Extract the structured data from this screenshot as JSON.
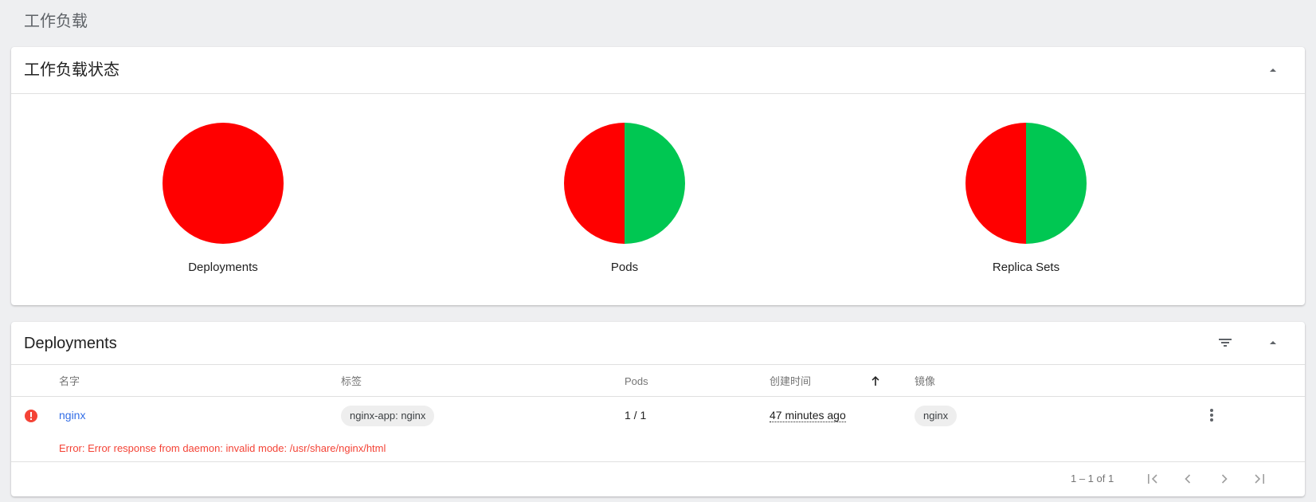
{
  "page": {
    "title": "工作负载"
  },
  "status_card": {
    "title": "工作负载状态",
    "charts": [
      {
        "label": "Deployments",
        "failed": 1,
        "running": 0
      },
      {
        "label": "Pods",
        "failed": 1,
        "running": 1
      },
      {
        "label": "Replica Sets",
        "failed": 1,
        "running": 1
      }
    ],
    "colors": {
      "failed": "#ff0000",
      "running": "#00c752"
    }
  },
  "deployments_card": {
    "title": "Deployments",
    "columns": {
      "name": "名字",
      "labels": "标签",
      "pods": "Pods",
      "created": "创建时间",
      "images": "镜像"
    },
    "rows": [
      {
        "status": "error",
        "name": "nginx",
        "label": "nginx-app: nginx",
        "pods": "1 / 1",
        "created": "47 minutes ago",
        "image": "nginx",
        "error": "Error: Error response from daemon: invalid mode: /usr/share/nginx/html"
      }
    ],
    "pagination": {
      "range": "1 – 1 of 1"
    }
  },
  "icons": {
    "collapse": "chevron-up-icon",
    "filter": "filter-icon",
    "sort": "arrow-up-icon",
    "row_status": "error-icon",
    "row_menu": "more-vert-icon",
    "pager": [
      "first-page-icon",
      "prev-page-icon",
      "next-page-icon",
      "last-page-icon"
    ]
  },
  "theme": {
    "error": "#f44336",
    "link": "#326de6"
  }
}
